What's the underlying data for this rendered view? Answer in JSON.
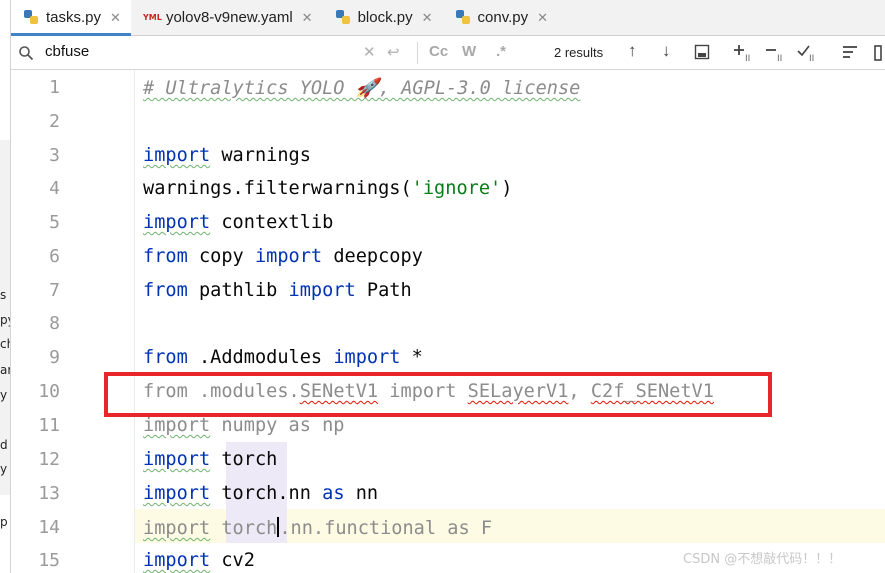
{
  "tabs": [
    {
      "label": "tasks.py",
      "icon": "python-file-icon",
      "active": true
    },
    {
      "label": "yolov8-v9new.yaml",
      "icon": "yaml-file-icon",
      "active": false
    },
    {
      "label": "block.py",
      "icon": "python-file-icon",
      "active": false
    },
    {
      "label": "conv.py",
      "icon": "python-file-icon",
      "active": false
    }
  ],
  "find": {
    "query": "cbfuse",
    "results": "2 results",
    "options": [
      "Cc",
      "W",
      ".*"
    ]
  },
  "left_panel_fragments": [
    "s",
    "py",
    "ch",
    "ar",
    "y",
    "d",
    "y",
    "p"
  ],
  "watermark": "CSDN @不想敲代码！！！",
  "highlight_color": "#e8262b",
  "editor": {
    "lines": [
      {
        "n": "1"
      },
      {
        "n": "2"
      },
      {
        "n": "3"
      },
      {
        "n": "4"
      },
      {
        "n": "5"
      },
      {
        "n": "6"
      },
      {
        "n": "7"
      },
      {
        "n": "8"
      },
      {
        "n": "9"
      },
      {
        "n": "10"
      },
      {
        "n": "11"
      },
      {
        "n": "12"
      },
      {
        "n": "13"
      },
      {
        "n": "14"
      },
      {
        "n": "15"
      }
    ],
    "tokens": {
      "l1": "# Ultralytics YOLO 🚀, AGPL-3.0 license",
      "l3_kw": "import",
      "l3_rest": " warnings",
      "l4_a": "warnings.filterwarnings(",
      "l4_str": "'ignore'",
      "l4_b": ")",
      "l5_kw": "import",
      "l5_rest": " contextlib",
      "l6_kw1": "from",
      "l6_mid": " copy ",
      "l6_kw2": "import",
      "l6_rest": " deepcopy",
      "l7_kw1": "from",
      "l7_mid": " pathlib ",
      "l7_kw2": "import",
      "l7_rest": " Path",
      "l9_kw1": "from",
      "l9_mid": " .Addmodules ",
      "l9_kw2": "import",
      "l9_rest": " *",
      "l10_a": "from .modules.",
      "l10_b": "SENetV1",
      "l10_c": " import ",
      "l10_d": "SELayerV1",
      "l10_e": ", ",
      "l10_f": "C2f_SENetV1",
      "l11_kw": "import",
      "l11_rest": " numpy as np",
      "l12_kw": "import",
      "l12_rest": " torch",
      "l13_kw1": "import",
      "l13_mid": " torch.nn ",
      "l13_kw2": "as",
      "l13_rest": " nn",
      "l14_a": "import",
      "l14_b": " torch",
      "l14_c": ".nn.functional as F",
      "l15_kw": "import",
      "l15_rest": " cv2"
    }
  }
}
